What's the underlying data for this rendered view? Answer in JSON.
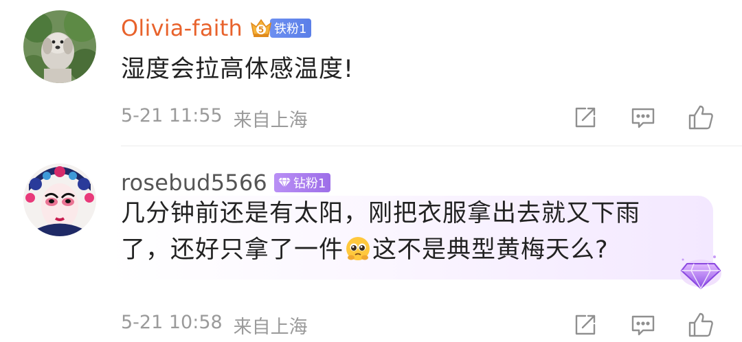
{
  "comments": [
    {
      "username": "Olivia-faith",
      "fan_level": "5",
      "fan_badge": "铁粉1",
      "text": "湿度会拉高体感温度!",
      "time": "5-21 11:55",
      "source": "来自上海"
    },
    {
      "username": "rosebud5566",
      "fan_badge": "钻粉1",
      "text_line1": "几分钟前还是有太阳，刚把衣服拿出去就又下雨",
      "text_line2a": "了，还好只拿了一件",
      "text_line2b": "这不是典型黄梅天么?",
      "time": "5-21 10:58",
      "source": "来自上海"
    }
  ],
  "icons": {
    "share": "share-icon",
    "reply": "comment-icon",
    "like": "thumbs-up-icon",
    "emoji": "pleading-face-emoji",
    "gem": "diamond-gem-icon"
  },
  "colors": {
    "username_highlight": "#e8622b",
    "iron_fan_badge": "#5b7fe8",
    "diamond_fan_badge": "#9d6ee8",
    "meta_text": "#9a9a9a"
  }
}
